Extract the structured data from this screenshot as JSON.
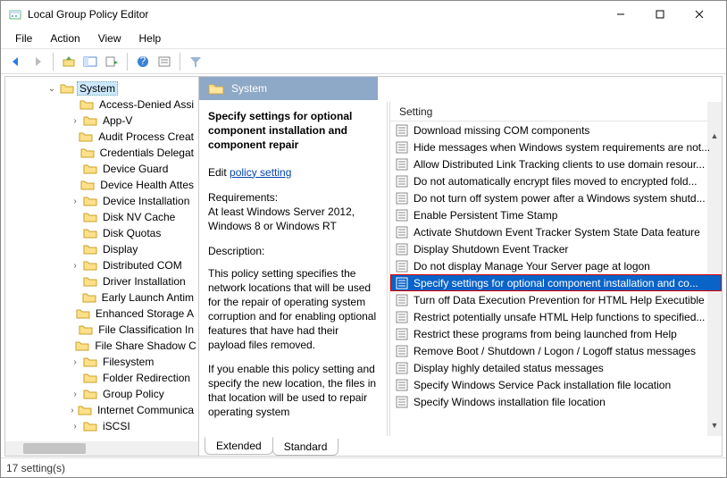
{
  "window": {
    "title": "Local Group Policy Editor"
  },
  "menu": {
    "file": "File",
    "action": "Action",
    "view": "View",
    "help": "Help"
  },
  "tree": {
    "root": "System",
    "items": [
      {
        "label": "Access-Denied Assi",
        "expand": "none"
      },
      {
        "label": "App-V",
        "expand": "closed"
      },
      {
        "label": "Audit Process Creat",
        "expand": "none"
      },
      {
        "label": "Credentials Delegat",
        "expand": "none"
      },
      {
        "label": "Device Guard",
        "expand": "none"
      },
      {
        "label": "Device Health Attes",
        "expand": "none"
      },
      {
        "label": "Device Installation",
        "expand": "closed"
      },
      {
        "label": "Disk NV Cache",
        "expand": "none"
      },
      {
        "label": "Disk Quotas",
        "expand": "none"
      },
      {
        "label": "Display",
        "expand": "none"
      },
      {
        "label": "Distributed COM",
        "expand": "closed"
      },
      {
        "label": "Driver Installation",
        "expand": "none"
      },
      {
        "label": "Early Launch Antim",
        "expand": "none"
      },
      {
        "label": "Enhanced Storage A",
        "expand": "none"
      },
      {
        "label": "File Classification In",
        "expand": "none"
      },
      {
        "label": "File Share Shadow C",
        "expand": "none"
      },
      {
        "label": "Filesystem",
        "expand": "closed"
      },
      {
        "label": "Folder Redirection",
        "expand": "none"
      },
      {
        "label": "Group Policy",
        "expand": "closed"
      },
      {
        "label": "Internet Communica",
        "expand": "closed"
      },
      {
        "label": "iSCSI",
        "expand": "closed"
      }
    ]
  },
  "header": {
    "title": "System"
  },
  "desc": {
    "title": "Specify settings for optional component installation and component repair",
    "edit_prefix": "Edit ",
    "edit_link": "policy setting",
    "requirements_label": "Requirements:",
    "requirements_text": "At least Windows Server 2012, Windows 8 or Windows RT",
    "description_label": "Description:",
    "description_p1": "This policy setting specifies the network locations that will be used for the repair of operating system corruption and for enabling optional features that have had their payload files removed.",
    "description_p2": "If you enable this policy setting and specify the new location, the files in that location will be used to repair operating system"
  },
  "list": {
    "header": "Setting",
    "items": [
      {
        "label": "Download missing COM components",
        "selected": false
      },
      {
        "label": "Hide messages when Windows system requirements are not...",
        "selected": false
      },
      {
        "label": "Allow Distributed Link Tracking clients to use domain resour...",
        "selected": false
      },
      {
        "label": "Do not automatically encrypt files moved to encrypted fold...",
        "selected": false
      },
      {
        "label": "Do not turn off system power after a Windows system shutd...",
        "selected": false
      },
      {
        "label": "Enable Persistent Time Stamp",
        "selected": false
      },
      {
        "label": "Activate Shutdown Event Tracker System State Data feature",
        "selected": false
      },
      {
        "label": "Display Shutdown Event Tracker",
        "selected": false
      },
      {
        "label": "Do not display Manage Your Server page at logon",
        "selected": false
      },
      {
        "label": "Specify settings for optional component installation and co...",
        "selected": true
      },
      {
        "label": "Turn off Data Execution Prevention for HTML Help Executible",
        "selected": false
      },
      {
        "label": "Restrict potentially unsafe HTML Help functions to specified...",
        "selected": false
      },
      {
        "label": "Restrict these programs from being launched from Help",
        "selected": false
      },
      {
        "label": "Remove Boot / Shutdown / Logon / Logoff status messages",
        "selected": false
      },
      {
        "label": "Display highly detailed status messages",
        "selected": false
      },
      {
        "label": "Specify Windows Service Pack installation file location",
        "selected": false
      },
      {
        "label": "Specify Windows installation file location",
        "selected": false
      }
    ]
  },
  "tabs": {
    "extended": "Extended",
    "standard": "Standard"
  },
  "status": {
    "text": "17 setting(s)"
  }
}
